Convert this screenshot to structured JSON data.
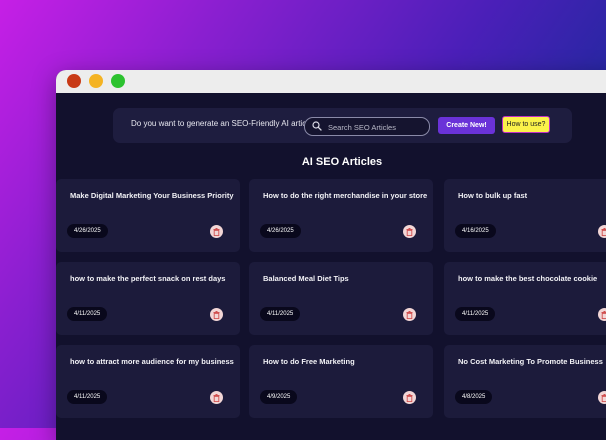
{
  "window": {
    "controls": [
      "close",
      "minimize",
      "maximize"
    ]
  },
  "toolbar": {
    "prompt": "Do you want to generate an SEO-Friendly AI article?",
    "search_placeholder": "Search SEO Articles",
    "create_label": "Create New!",
    "how_label": "How to use?"
  },
  "section_title": "AI SEO Articles",
  "articles": [
    {
      "title": "Make Digital Marketing Your Business Priority",
      "date": "4/26/2025"
    },
    {
      "title": "How to do the right merchandise in your store",
      "date": "4/26/2025"
    },
    {
      "title": "How to bulk up fast",
      "date": "4/16/2025"
    },
    {
      "title": "how to make the perfect snack on rest days",
      "date": "4/11/2025"
    },
    {
      "title": "Balanced Meal Diet Tips",
      "date": "4/11/2025"
    },
    {
      "title": "how to make the best chocolate cookie",
      "date": "4/11/2025"
    },
    {
      "title": "how to attract more audience for my business",
      "date": "4/11/2025"
    },
    {
      "title": "How to do Free Marketing",
      "date": "4/9/2025"
    },
    {
      "title": "No Cost Marketing To Promote Business",
      "date": "4/8/2025"
    }
  ],
  "colors": {
    "accent": "#6a32d8",
    "highlight": "#fbf24a",
    "card": "#1c1b3b",
    "background": "#12112d"
  },
  "icons": {
    "search": "search-icon",
    "delete": "trash-icon"
  }
}
